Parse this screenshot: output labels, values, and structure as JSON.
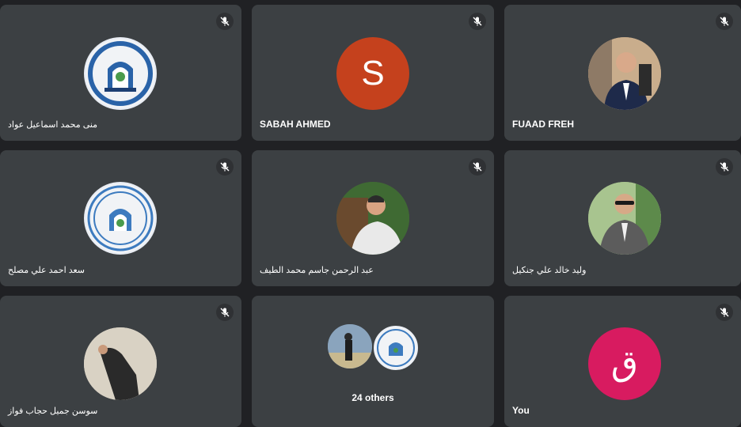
{
  "participants": [
    {
      "name": "منى محمد اسماعيل عواد",
      "muted": true,
      "avatar": "logo-icon"
    },
    {
      "name": "SABAH AHMED",
      "muted": true,
      "avatar_letter": "S",
      "avatar_color": "#c5411d"
    },
    {
      "name": "FUAAD FREH",
      "muted": true,
      "avatar": "photo"
    },
    {
      "name": "سعد احمد علي مصلح",
      "muted": true,
      "avatar": "logo-icon"
    },
    {
      "name": "عبد الرحمن جاسم محمد الطيف",
      "muted": true,
      "avatar": "photo"
    },
    {
      "name": "وليد خالد علي جنكيل",
      "muted": true,
      "avatar": "photo"
    },
    {
      "name": "سوسن جميل حجاب فواز",
      "muted": true,
      "avatar": "photo"
    },
    {
      "others_label": "24 others"
    },
    {
      "name": "You",
      "muted": true,
      "avatar_letter": "ق",
      "avatar_color": "#d81b60"
    }
  ],
  "colors": {
    "background": "#202124",
    "tile": "#3c4043",
    "mic_badge": "#2f3134"
  }
}
